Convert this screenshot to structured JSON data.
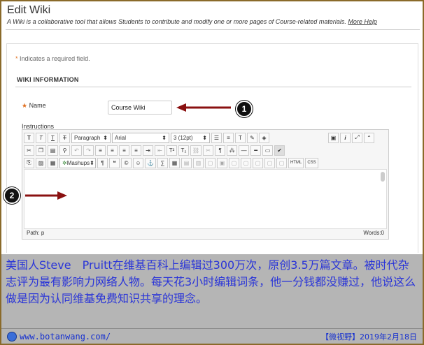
{
  "page": {
    "title": "Edit Wiki",
    "subtitle": "A Wiki is a collaborative tool that allows Students to contribute and modify one or more pages of Course-related materials.",
    "more_help": "More Help",
    "required_note": "Indicates a required field.",
    "section_title": "WIKI INFORMATION"
  },
  "form": {
    "name_label": "Name",
    "name_value": "Course Wiki",
    "instructions_label": "Instructions"
  },
  "editor": {
    "row1": {
      "format": "Paragraph",
      "font": "Arial",
      "size": "3 (12pt)"
    },
    "row3": {
      "mashups": "Mashups",
      "html": "HTML",
      "css": "CSS"
    },
    "path": "Path: p",
    "words": "Words:0"
  },
  "callouts": {
    "one": "1",
    "two": "2"
  },
  "caption": {
    "text": "美国人Steve　Pruitt在维基百科上编辑过300万次，原创3.5万篇文章。被时代杂志评为最有影响力网络人物。每天花3小时编辑词条，他一分钱都没赚过，他说这么做是因为认同维基免费知识共享的理念。"
  },
  "footer": {
    "site": "www.botanwang.com/",
    "date": "【微视野】2019年2月18日"
  }
}
